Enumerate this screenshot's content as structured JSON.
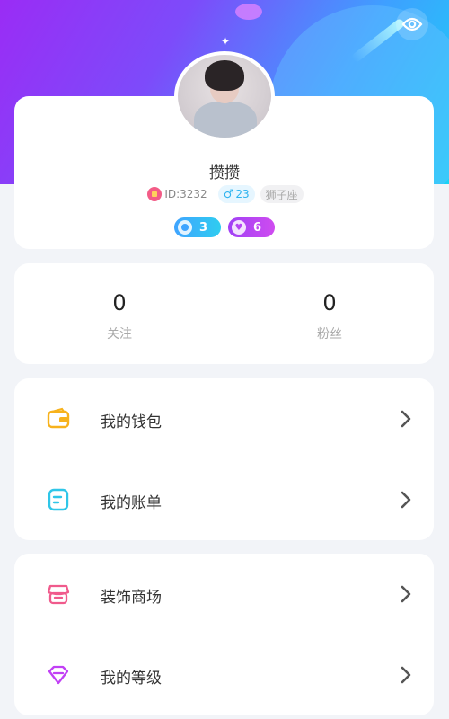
{
  "profile": {
    "nickname": "攒攒",
    "id_text": "ID:3232",
    "gender_age": "23",
    "zodiac": "狮子座",
    "level_1": "3",
    "level_2": "6"
  },
  "stats": [
    {
      "value": "0",
      "label": "关注"
    },
    {
      "value": "0",
      "label": "粉丝"
    }
  ],
  "menu_group_1": [
    {
      "label": "我的钱包",
      "icon": "wallet-icon"
    },
    {
      "label": "我的账单",
      "icon": "bill-icon"
    }
  ],
  "menu_group_2": [
    {
      "label": "装饰商场",
      "icon": "store-icon"
    },
    {
      "label": "我的等级",
      "icon": "level-gem-icon"
    }
  ],
  "colors": {
    "header_gradient_start": "#9a2cf5",
    "header_gradient_end": "#19d4f6",
    "wallet_icon": "#f7b21c",
    "bill_icon": "#2fc6e8",
    "store_icon": "#f05a8c",
    "level_icon": "#c140f5"
  }
}
